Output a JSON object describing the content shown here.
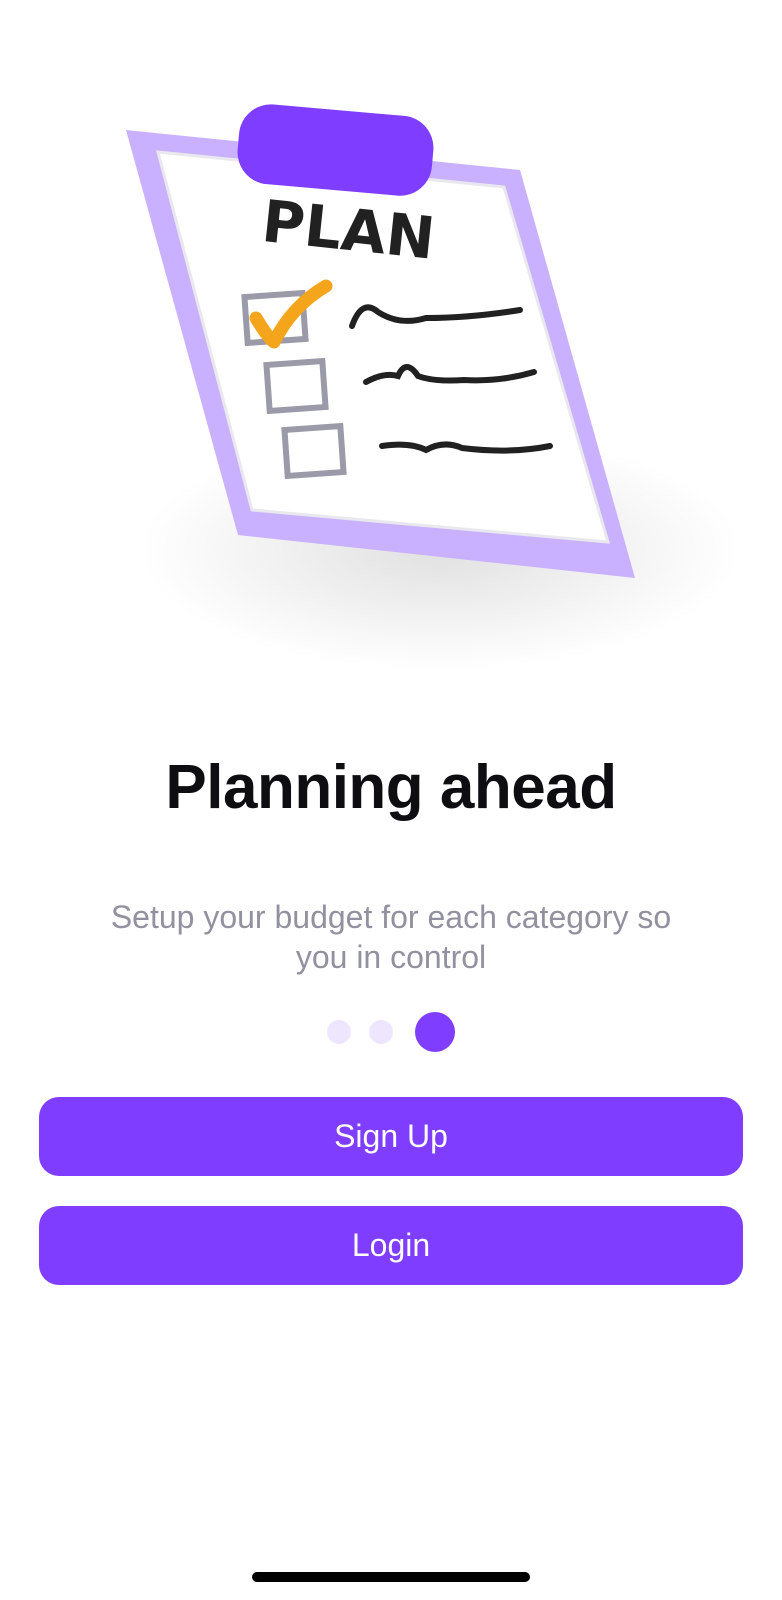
{
  "illustration": {
    "board_text": "PLAN",
    "icon": "clipboard-plan-illustration",
    "colors": {
      "frame": "#c9b1ff",
      "clip": "#7f3dff",
      "check": "#f4a51c",
      "ink": "#212121",
      "checkbox": "#9a9aa8"
    }
  },
  "onboarding": {
    "title": "Planning ahead",
    "subtitle": "Setup your budget for each category so you in control",
    "page_count": 3,
    "active_page": 3
  },
  "actions": {
    "signup_label": "Sign Up",
    "login_label": "Login"
  },
  "colors": {
    "primary": "#7f3dff",
    "dot_inactive": "#eee5ff",
    "title": "#0d0d12",
    "subtitle": "#91919f",
    "background": "#ffffff"
  }
}
